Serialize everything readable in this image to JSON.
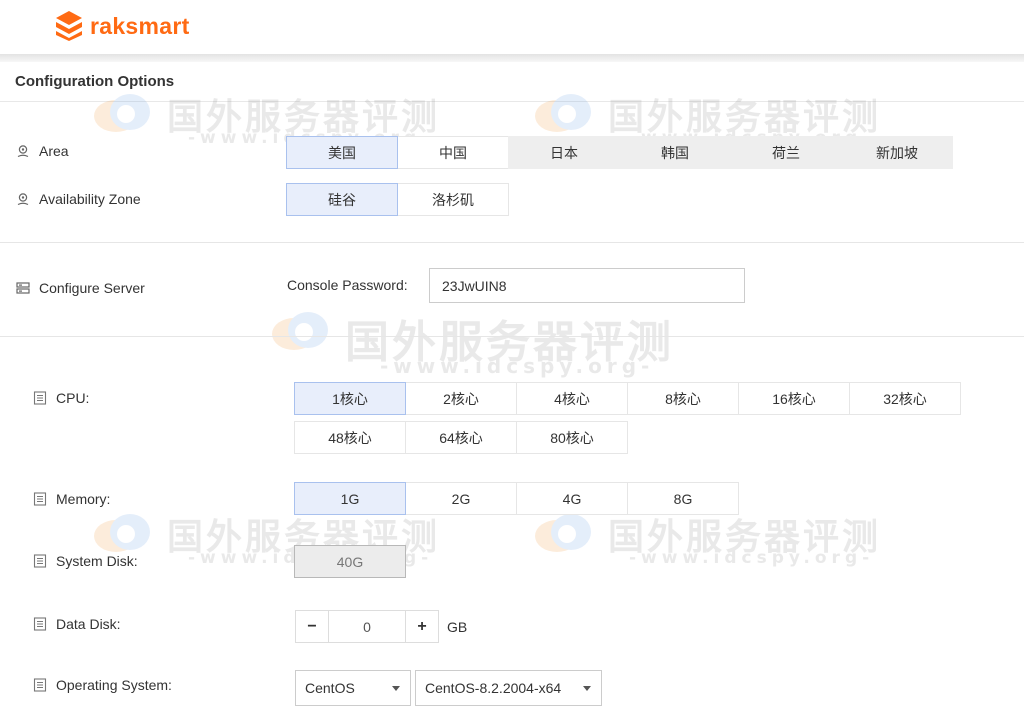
{
  "brand": {
    "name": "raksmart",
    "color": "#ff6a13"
  },
  "section_title": "Configuration Options",
  "watermark": {
    "text_cn": "国外服务器评测",
    "text_url": "-www.idcspy.org-"
  },
  "area": {
    "label": "Area",
    "options": [
      "美国",
      "中国",
      "日本",
      "韩国",
      "荷兰",
      "新加坡"
    ],
    "selected": "美国"
  },
  "availability_zone": {
    "label": "Availability Zone",
    "options": [
      "硅谷",
      "洛杉矶"
    ],
    "selected": "硅谷"
  },
  "configure_server": {
    "label": "Configure Server",
    "console_password_label": "Console Password:",
    "console_password_value": "23JwUIN8"
  },
  "cpu": {
    "label": "CPU:",
    "options": [
      "1核心",
      "2核心",
      "4核心",
      "8核心",
      "16核心",
      "32核心",
      "48核心",
      "64核心",
      "80核心"
    ],
    "selected": "1核心"
  },
  "memory": {
    "label": "Memory:",
    "options": [
      "1G",
      "2G",
      "4G",
      "8G"
    ],
    "selected": "1G"
  },
  "system_disk": {
    "label": "System Disk:",
    "value": "40G"
  },
  "data_disk": {
    "label": "Data Disk:",
    "minus": "−",
    "plus": "+",
    "value": "0",
    "unit": "GB"
  },
  "operating_system": {
    "label": "Operating System:",
    "os_family": "CentOS",
    "os_version": "CentOS-8.2.2004-x64"
  },
  "colors": {
    "selected_bg": "#e8eefb",
    "selected_border": "#a9c1ee",
    "accent": "#ff6a13"
  }
}
